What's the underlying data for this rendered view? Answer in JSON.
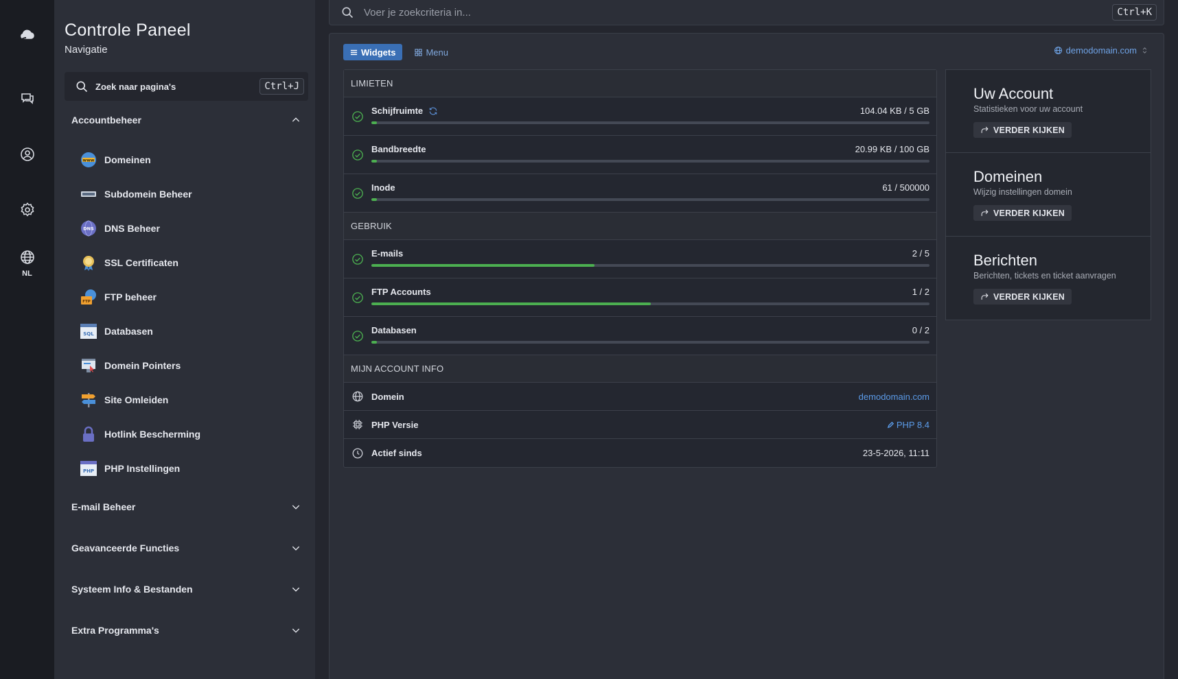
{
  "rail": {
    "items": [
      {
        "icon": "cloud-hand-icon"
      },
      {
        "icon": "chat-icon"
      },
      {
        "icon": "user-circle-icon"
      },
      {
        "icon": "gear-icon"
      },
      {
        "icon": "globe-icon",
        "label": "NL"
      }
    ]
  },
  "sidebar": {
    "title": "Controle Paneel",
    "subtitle": "Navigatie",
    "search": {
      "placeholder": "Zoek naar pagina's",
      "shortcut": "Ctrl+J"
    },
    "sections": {
      "account": "Accountbeheer",
      "email": "E-mail Beheer",
      "advanced": "Geavanceerde Functies",
      "system": "Systeem Info & Bestanden",
      "extra": "Extra Programma's"
    },
    "items": [
      {
        "label": "Domeinen",
        "icon": "www-globe-icon"
      },
      {
        "label": "Subdomein Beheer",
        "icon": "subdomain-icon"
      },
      {
        "label": "DNS Beheer",
        "icon": "dns-globe-icon"
      },
      {
        "label": "SSL Certificaten",
        "icon": "ssl-badge-icon"
      },
      {
        "label": "FTP beheer",
        "icon": "ftp-folder-icon"
      },
      {
        "label": "Databasen",
        "icon": "sql-database-icon"
      },
      {
        "label": "Domein Pointers",
        "icon": "domain-pointer-icon"
      },
      {
        "label": "Site Omleiden",
        "icon": "signpost-icon"
      },
      {
        "label": "Hotlink Bescherming",
        "icon": "padlock-icon"
      },
      {
        "label": "PHP Instellingen",
        "icon": "php-window-icon"
      }
    ]
  },
  "topbar": {
    "placeholder": "Voer je zoekcriteria in...",
    "shortcut": "Ctrl+K"
  },
  "main": {
    "tabs": {
      "widgets": "Widgets",
      "menu": "Menu"
    },
    "domain_selector": "demodomain.com",
    "limits": {
      "heading": "LIMIETEN",
      "rows": [
        {
          "label": "Schijfruimte",
          "value": "104.04 KB / 5 GB",
          "fraction": 0.01
        },
        {
          "label": "Bandbreedte",
          "value": "20.99 KB / 100 GB",
          "fraction": 0.01
        },
        {
          "label": "Inode",
          "value": "61 / 500000",
          "fraction": 0.01
        }
      ]
    },
    "usage": {
      "heading": "GEBRUIK",
      "rows": [
        {
          "label": "E-mails",
          "value": "2 / 5",
          "fraction": 0.4
        },
        {
          "label": "FTP Accounts",
          "value": "1 / 2",
          "fraction": 0.5
        },
        {
          "label": "Databasen",
          "value": "0 / 2",
          "fraction": 0.01
        }
      ]
    },
    "account_info": {
      "heading": "MIJN ACCOUNT INFO",
      "domain_label": "Domein",
      "domain_value": "demodomain.com",
      "php_label": "PHP Versie",
      "php_value": "PHP 8.4",
      "since_label": "Actief sinds",
      "since_value": "23-5-2026, 11:11"
    },
    "widgets": [
      {
        "title": "Uw Account",
        "subtitle": "Statistieken voor uw account",
        "button": "VERDER KIJKEN"
      },
      {
        "title": "Domeinen",
        "subtitle": "Wijzig instellingen domein",
        "button": "VERDER KIJKEN"
      },
      {
        "title": "Berichten",
        "subtitle": "Berichten, tickets en ticket aanvragen",
        "button": "VERDER KIJKEN"
      }
    ]
  },
  "colors": {
    "accent": "#3a6fb5",
    "link": "#5b9be8",
    "success": "#4caf50"
  }
}
